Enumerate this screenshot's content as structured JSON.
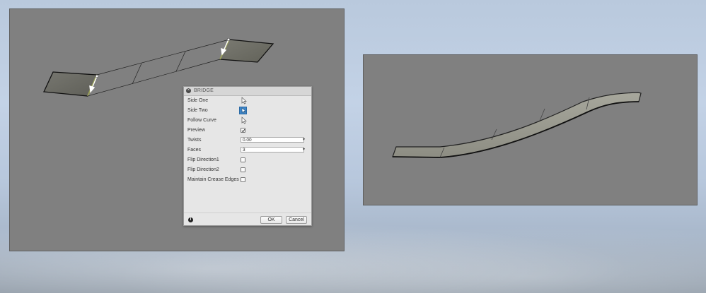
{
  "dialog": {
    "title": "BRIDGE",
    "rows": [
      {
        "label": "Side One",
        "control": "selector"
      },
      {
        "label": "Side Two",
        "control": "selector-active"
      },
      {
        "label": "Follow Curve",
        "control": "selector"
      },
      {
        "label": "Preview",
        "control": "checkbox",
        "checked": true
      },
      {
        "label": "Twists",
        "control": "dropdown",
        "value": "0.00"
      },
      {
        "label": "Faces",
        "control": "dropdown",
        "value": "3"
      },
      {
        "label": "Flip Direction1",
        "control": "checkbox",
        "checked": false
      },
      {
        "label": "Flip Direction2",
        "control": "checkbox",
        "checked": false
      },
      {
        "label": "Maintain Crease Edges",
        "control": "checkbox",
        "checked": false
      }
    ],
    "ok_label": "OK",
    "cancel_label": "Cancel",
    "icons": {
      "close": "close-icon",
      "info": "info-icon",
      "selector": "cursor-arrow-icon"
    }
  },
  "colors": {
    "viewport_bg": "#808080",
    "surface": "#6e6e66",
    "selection_button": "#3f86c8"
  }
}
